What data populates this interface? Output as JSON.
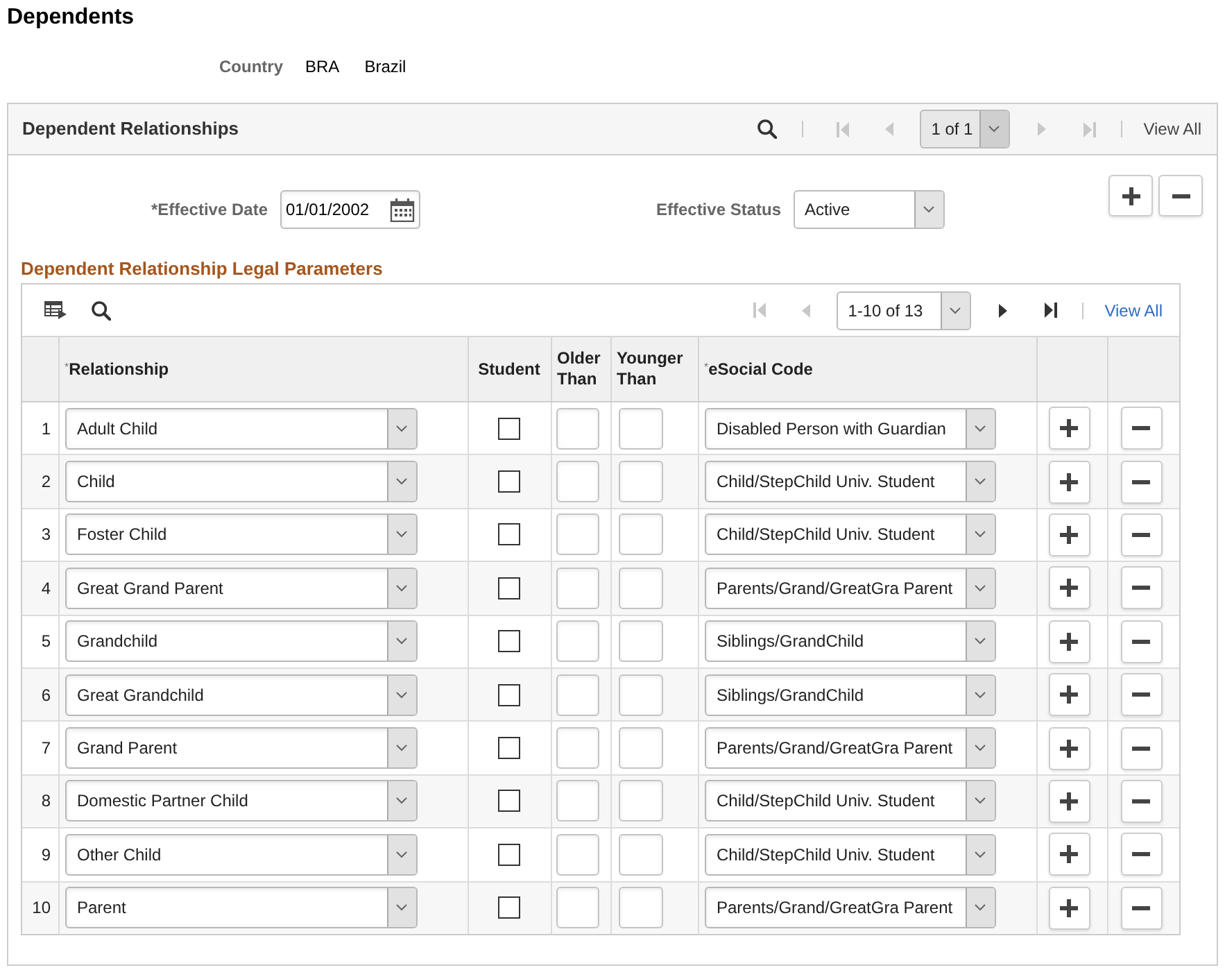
{
  "page": {
    "title": "Dependents"
  },
  "country": {
    "label": "Country",
    "code": "BRA",
    "description": "Brazil"
  },
  "panel": {
    "title": "Dependent Relationships",
    "pager": {
      "first": {
        "disabled": true
      },
      "previous": {
        "disabled": true
      },
      "range": {
        "text": "1 of 1",
        "disabled": true
      },
      "next": {
        "disabled": true
      },
      "last": {
        "disabled": true
      },
      "view_all": {
        "label": "View All",
        "disabled": true
      }
    },
    "effective_date": {
      "label": "*Effective Date",
      "value": "01/01/2002"
    },
    "effective_status": {
      "label": "Effective Status",
      "value": "Active"
    },
    "grid": {
      "title": "Dependent Relationship Legal Parameters",
      "pager": {
        "first": {
          "disabled": true
        },
        "previous": {
          "disabled": true
        },
        "range": {
          "text": "1-10 of 13",
          "disabled": false
        },
        "next": {
          "disabled": false
        },
        "last": {
          "disabled": false
        },
        "view_all": {
          "label": "View All",
          "disabled": false
        }
      },
      "columns": [
        "$^{*}$Relationship",
        "Student",
        "Older Than",
        "Younger Than",
        "$^{*}$eSocial Code"
      ],
      "rows": [
        {
          "number": "1",
          "relationship": "Adult Child",
          "student_checked": false,
          "esocial_code": "Disabled Person with Guardian"
        },
        {
          "number": "2",
          "relationship": "Child",
          "student_checked": false,
          "esocial_code": "Child/StepChild Univ. Student"
        },
        {
          "number": "3",
          "relationship": "Foster Child",
          "student_checked": false,
          "esocial_code": "Child/StepChild Univ. Student"
        },
        {
          "number": "4",
          "relationship": "Great Grand Parent",
          "student_checked": false,
          "esocial_code": "Parents/Grand/GreatGra Parent"
        },
        {
          "number": "5",
          "relationship": "Grandchild",
          "student_checked": false,
          "esocial_code": "Siblings/GrandChild"
        },
        {
          "number": "6",
          "relationship": "Great Grandchild",
          "student_checked": false,
          "esocial_code": "Siblings/GrandChild"
        },
        {
          "number": "7",
          "relationship": "Grand Parent",
          "student_checked": false,
          "esocial_code": "Parents/Grand/GreatGra Parent"
        },
        {
          "number": "8",
          "relationship": "Domestic Partner Child",
          "student_checked": false,
          "esocial_code": "Child/StepChild Univ. Student"
        },
        {
          "number": "9",
          "relationship": "Other Child",
          "student_checked": false,
          "esocial_code": "Child/StepChild Univ. Student"
        },
        {
          "number": "10",
          "relationship": "Parent",
          "student_checked": false,
          "esocial_code": "Parents/Grand/GreatGra Parent"
        }
      ]
    }
  }
}
